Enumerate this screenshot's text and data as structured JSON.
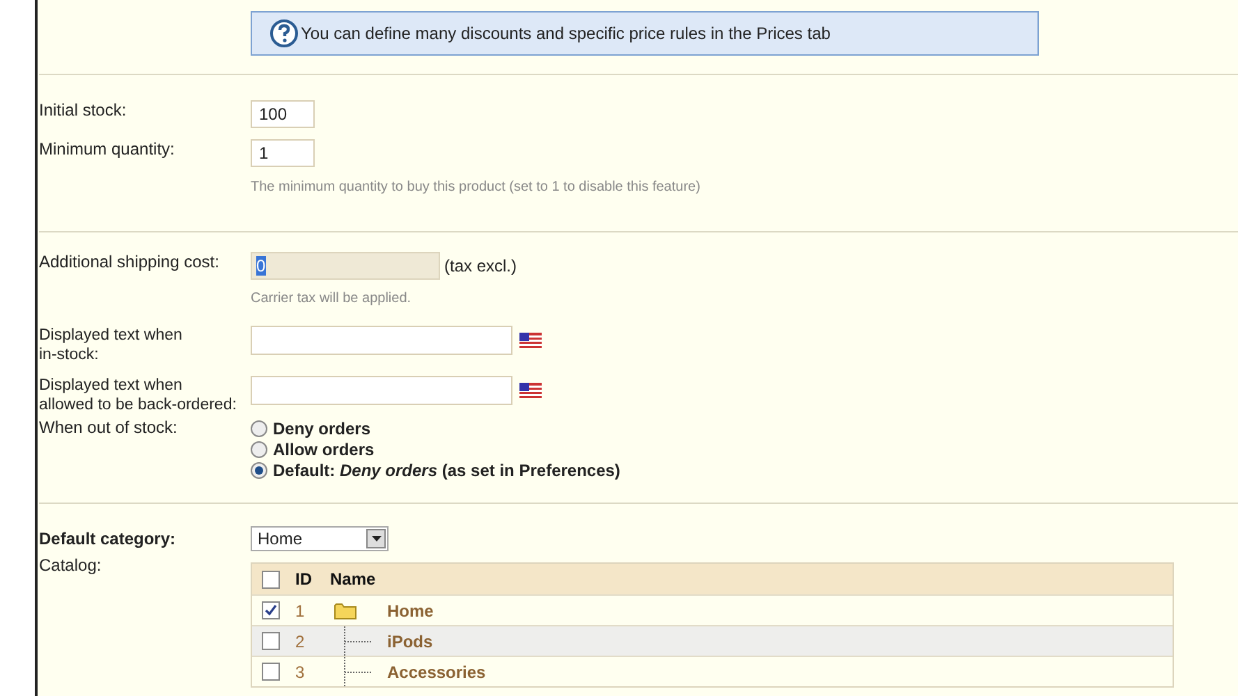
{
  "info_box": {
    "text": "You can define many discounts and specific price rules in the Prices tab"
  },
  "stock": [
    {
      "label": "Initial stock:",
      "value": "100"
    },
    {
      "label": "Minimum quantity:",
      "value": "1",
      "hint": "The minimum quantity to buy this product (set to 1 to disable this feature)"
    }
  ],
  "shipping": {
    "label": "Additional shipping cost:",
    "value": "0",
    "suffix": "(tax excl.)",
    "hint": "Carrier tax will be applied."
  },
  "displayed_texts": [
    {
      "label": "Displayed text when\nin-stock:"
    },
    {
      "label": "Displayed text when\nallowed to be back-ordered:"
    }
  ],
  "out_of_stock": {
    "label": "When out of stock:",
    "options": [
      {
        "text": "Deny orders",
        "selected": false
      },
      {
        "text": "Allow orders",
        "selected": false
      },
      {
        "text": "Default: *Deny orders* (as set in Preferences)",
        "selected": true
      }
    ]
  },
  "default_category": {
    "label": "Default category:",
    "value": "Home"
  },
  "catalog": {
    "label": "Catalog:",
    "columns": [
      "ID",
      "Name"
    ],
    "header_checked": false,
    "rows": [
      {
        "id": "1",
        "name": "Home",
        "checked": true,
        "kind": "folder"
      },
      {
        "id": "2",
        "name": "iPods",
        "checked": false,
        "kind": "child"
      },
      {
        "id": "3",
        "name": "Accessories",
        "checked": false,
        "kind": "child"
      }
    ]
  }
}
